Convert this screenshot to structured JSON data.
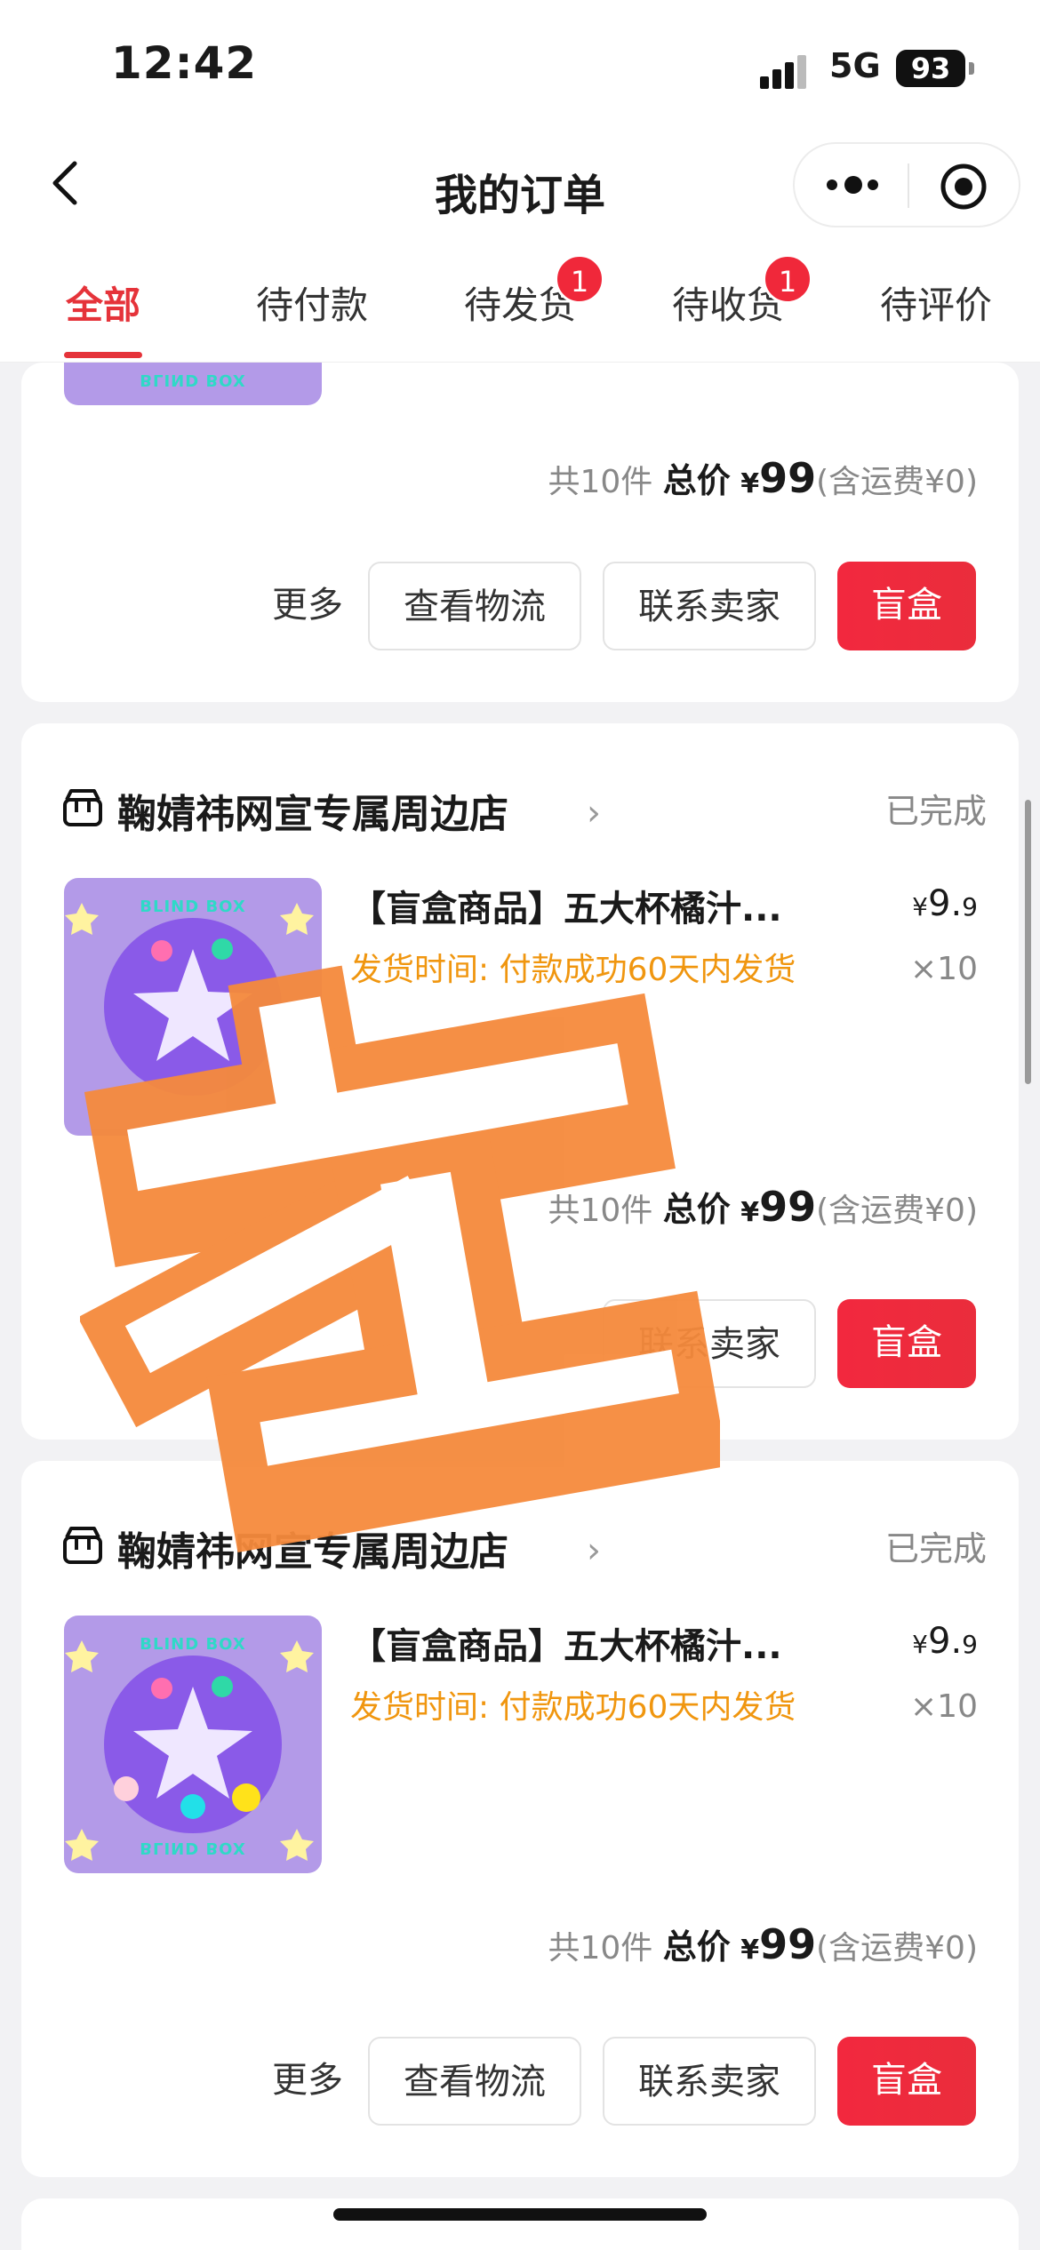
{
  "status_bar": {
    "time": "12:42",
    "network": "5G",
    "battery": "93"
  },
  "nav": {
    "title": "我的订单"
  },
  "tabs": [
    {
      "label": "全部",
      "active": true
    },
    {
      "label": "待付款"
    },
    {
      "label": "待发货",
      "badge": "1"
    },
    {
      "label": "待收货",
      "badge": "1"
    },
    {
      "label": "待评价"
    }
  ],
  "orders": [
    {
      "image_label": "BLIND BOX",
      "count_text": "共10件",
      "total_label": "总价",
      "currency": "¥",
      "total": "99",
      "shipping_note": "(含运费¥0)",
      "buttons": {
        "more": "更多",
        "logistics": "查看物流",
        "contact": "联系卖家",
        "primary": "盲盒"
      }
    },
    {
      "shop": "鞠婧祎网宣专属周边店",
      "status": "已完成",
      "image_label": "BLIND BOX",
      "title": "【盲盒商品】五大杯橘汁...",
      "ship_time": "发货时间: 付款成功60天内发货",
      "price_yen": "¥",
      "price_int": "9.",
      "price_dec": "9",
      "qty": "×10",
      "count_text": "共10件",
      "total_label": "总价",
      "currency": "¥",
      "total": "99",
      "shipping_note": "(含运费¥0)",
      "buttons": {
        "contact": "联系卖家",
        "primary": "盲盒"
      }
    },
    {
      "shop": "鞠婧祎网宣专属周边店",
      "status": "已完成",
      "image_label": "BLIND BOX",
      "title": "【盲盒商品】五大杯橘汁...",
      "ship_time": "发货时间: 付款成功60天内发货",
      "price_yen": "¥",
      "price_int": "9.",
      "price_dec": "9",
      "qty": "×10",
      "count_text": "共10件",
      "total_label": "总价",
      "currency": "¥",
      "total": "99",
      "shipping_note": "(含运费¥0)",
      "buttons": {
        "more": "更多",
        "logistics": "查看物流",
        "contact": "联系卖家",
        "primary": "盲盒"
      }
    }
  ],
  "colors": {
    "accent": "#e5333a",
    "ship_time": "#f0960f",
    "stamp": "#f58a3c"
  },
  "icons": [
    "back-arrow-icon",
    "more-dots-icon",
    "target-icon",
    "shop-icon",
    "chevron-right-icon"
  ]
}
